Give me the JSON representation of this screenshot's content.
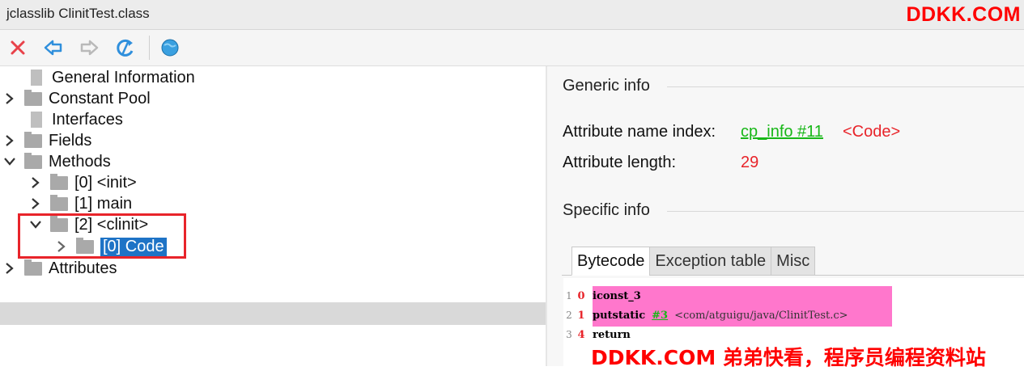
{
  "window": {
    "title": "jclasslib ClinitTest.class"
  },
  "watermarks": {
    "top": "DDKK.COM",
    "bottom": "DDKK.COM 弟弟快看，程序员编程资料站"
  },
  "toolbar": {
    "buttons": [
      {
        "icon": "close-icon",
        "color": "#e8424a"
      },
      {
        "icon": "back-arrow-icon",
        "color": "#2f8fdc"
      },
      {
        "icon": "forward-arrow-icon",
        "color": "#b9b9b9"
      },
      {
        "icon": "refresh-icon",
        "color": "#2f8fdc"
      },
      {
        "icon": "web-icon",
        "color": "#3aa0e0"
      }
    ]
  },
  "tree": {
    "items": [
      {
        "label": "General Information",
        "type": "leaf"
      },
      {
        "label": "Constant Pool",
        "type": "folder",
        "state": "collapsed"
      },
      {
        "label": "Interfaces",
        "type": "leaf"
      },
      {
        "label": "Fields",
        "type": "folder",
        "state": "collapsed"
      },
      {
        "label": "Methods",
        "type": "folder",
        "state": "expanded"
      },
      {
        "label": "[0] <init>",
        "type": "folder",
        "state": "collapsed"
      },
      {
        "label": "[1] main",
        "type": "folder",
        "state": "collapsed"
      },
      {
        "label": "[2] <clinit>",
        "type": "folder",
        "state": "expanded"
      },
      {
        "label": "[0] Code",
        "type": "folder",
        "state": "collapsed",
        "selected": true
      },
      {
        "label": "Attributes",
        "type": "folder",
        "state": "collapsed"
      }
    ]
  },
  "generic_info": {
    "title": "Generic info",
    "name_index_label": "Attribute name index:",
    "name_index_link": "cp_info #11",
    "name_index_value": "<Code>",
    "length_label": "Attribute length:",
    "length_value": "29"
  },
  "specific_info": {
    "title": "Specific info",
    "tabs": [
      "Bytecode",
      "Exception table",
      "Misc"
    ],
    "active_tab": "Bytecode"
  },
  "bytecode": [
    {
      "line": "1",
      "offset": "0",
      "instruction": "iconst_3",
      "cp_ref": "",
      "comment": ""
    },
    {
      "line": "2",
      "offset": "1",
      "instruction": "putstatic",
      "cp_ref": "#3",
      "comment": "<com/atguigu/java/ClinitTest.c>"
    },
    {
      "line": "3",
      "offset": "4",
      "instruction": "return",
      "cp_ref": "",
      "comment": ""
    }
  ],
  "colors": {
    "selection": "#1e73c6",
    "highlight_box": "#e8242a",
    "link": "#17b717",
    "value_red": "#e8242a",
    "code_highlight": "#ff77cc"
  }
}
